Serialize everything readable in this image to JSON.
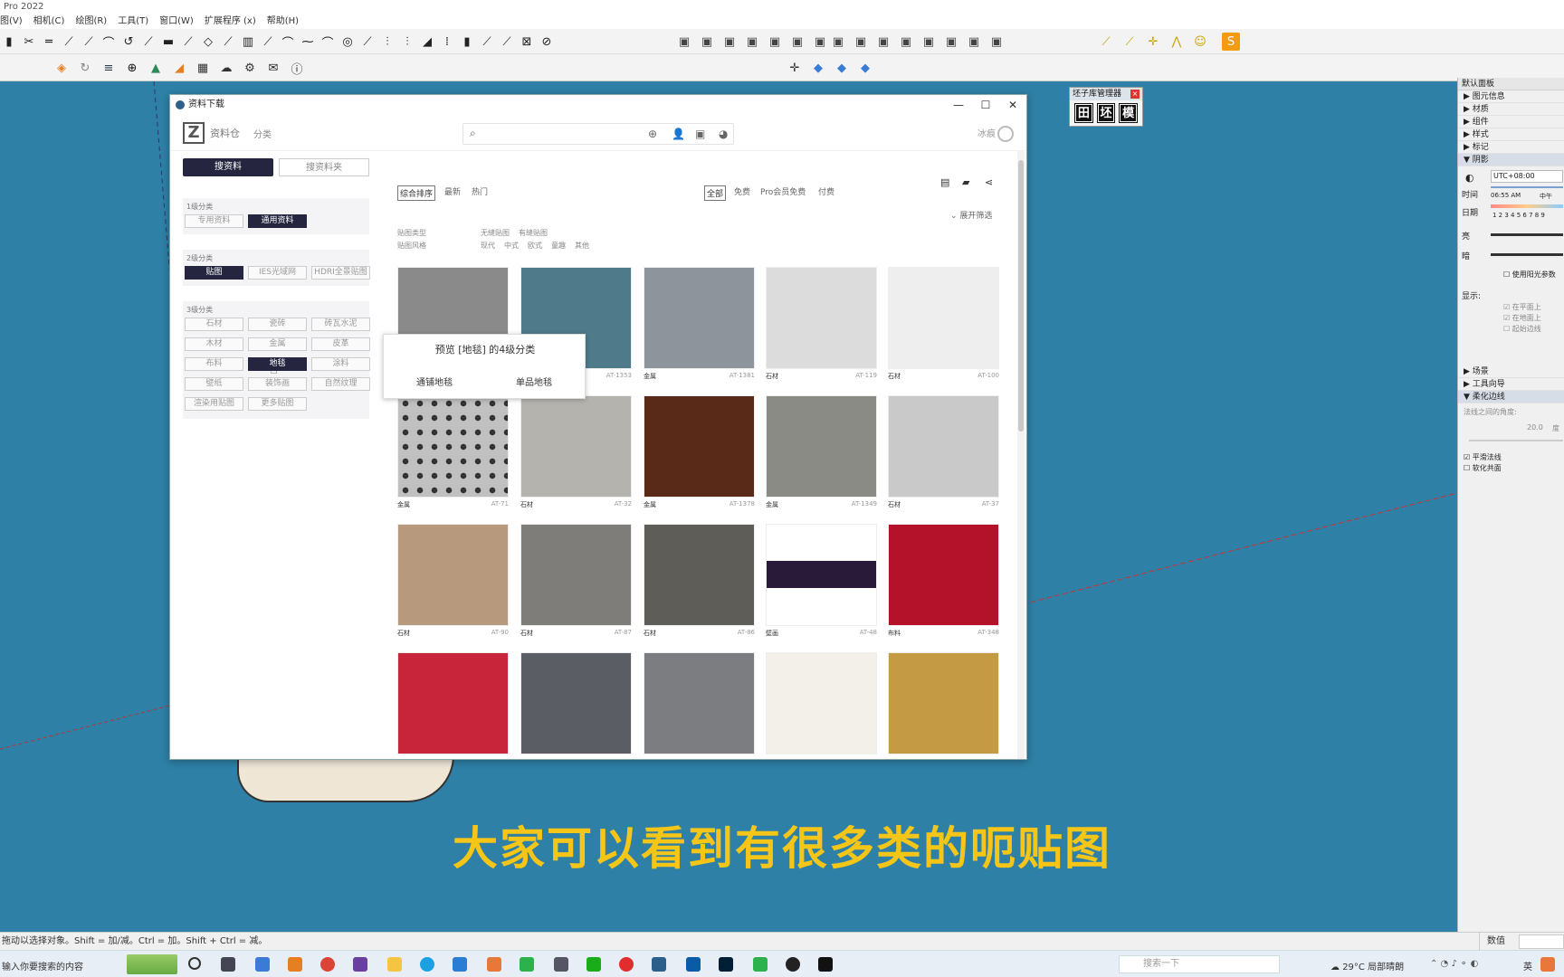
{
  "app": {
    "title": "Pro 2022"
  },
  "menu": [
    "图(V)",
    "相机(C)",
    "绘图(R)",
    "工具(T)",
    "窗口(W)",
    "扩展程序 (x)",
    "帮助(H)"
  ],
  "dialog": {
    "title": "资料下载",
    "brand": "资料仓",
    "brand_sub": "分类",
    "search_placeholder": "",
    "username": "冰痕",
    "tab_search_material": "搜资料",
    "tab_search_set": "搜资料夹",
    "level1": {
      "title": "1级分类",
      "items": [
        "专用资料",
        "通用资料"
      ],
      "active": "通用资料"
    },
    "level2": {
      "title": "2级分类",
      "items": [
        "贴图",
        "IES光域网",
        "HDRI全景贴图"
      ],
      "active": "贴图"
    },
    "level3": {
      "title": "3级分类",
      "items": [
        "石材",
        "瓷砖",
        "砖瓦水泥",
        "木材",
        "金属",
        "皮革",
        "布料",
        "地毯",
        "涂料",
        "壁纸",
        "装饰画",
        "自然纹理",
        "渲染用贴图",
        "更多贴图"
      ],
      "active": "地毯"
    },
    "sort": [
      "综合排序",
      "最新",
      "热门"
    ],
    "price": [
      "全部",
      "免费",
      "Pro会员免费",
      "付费"
    ],
    "expand": "展开筛选",
    "tag_type_label": "贴图类型",
    "tag_type": [
      "无缝贴图",
      "有缝贴图"
    ],
    "tag_style_label": "贴图风格",
    "tag_style": [
      "现代",
      "中式",
      "欧式",
      "童趣",
      "其他"
    ],
    "popup": {
      "title": "预览 [地毯] 的4级分类",
      "items": [
        "通铺地毯",
        "单品地毯"
      ]
    },
    "tiles": [
      {
        "label": "金属",
        "code": "AT-292",
        "color": "#8a8a8a"
      },
      {
        "label": "金属",
        "code": "AT-1353",
        "color": "#4f7a8a"
      },
      {
        "label": "金属",
        "code": "AT-1381",
        "color": "#8e949c"
      },
      {
        "label": "石材",
        "code": "AT-119",
        "color": "#dcdcdc"
      },
      {
        "label": "石材",
        "code": "AT-100",
        "color": "#eeeeee"
      },
      {
        "label": "金属",
        "code": "AT-71",
        "color": "#c0c0c0"
      },
      {
        "label": "石材",
        "code": "AT-32",
        "color": "#b5b3ae"
      },
      {
        "label": "金属",
        "code": "AT-1378",
        "color": "#5a2a18"
      },
      {
        "label": "金属",
        "code": "AT-1349",
        "color": "#8b8b86"
      },
      {
        "label": "石材",
        "code": "AT-37",
        "color": "#c9c9c9"
      },
      {
        "label": "石材",
        "code": "AT-90",
        "color": "#b79a7e"
      },
      {
        "label": "石材",
        "code": "AT-87",
        "color": "#7e7d7a"
      },
      {
        "label": "石材",
        "code": "AT-86",
        "color": "#5f5d58"
      },
      {
        "label": "壁画",
        "code": "AT-48",
        "color": "#ffffff"
      },
      {
        "label": "布料",
        "code": "AT-348",
        "color": "#b3122a"
      },
      {
        "label": "",
        "code": "",
        "color": "#c8253a"
      },
      {
        "label": "",
        "code": "",
        "color": "#5a5d63"
      },
      {
        "label": "",
        "code": "",
        "color": "#7b7d80"
      },
      {
        "label": "",
        "code": "",
        "color": "#f3f0ea"
      },
      {
        "label": "",
        "code": "",
        "color": "#c49a45"
      }
    ]
  },
  "component_manager": {
    "title": "坯子库管理器",
    "buttons": [
      "田",
      "坯",
      "模"
    ]
  },
  "right_panel": {
    "header": "默认面板",
    "sections": [
      "图元信息",
      "材质",
      "组件",
      "样式",
      "标记",
      "阴影"
    ],
    "tz": "UTC+08:00",
    "time_label": "时间",
    "time_val": "06:55 AM",
    "time_mid": "中午",
    "date_label": "日期",
    "date_ticks": "1 2 3 4 5 6 7 8 9",
    "light": "亮",
    "dark": "暗",
    "use_sun": "使用阳光参数",
    "display": "显示:",
    "on_face": "在平面上",
    "on_ground": "在地面上",
    "from_edges": "起始边线",
    "more_sections": [
      "场景",
      "工具向导",
      "柔化边线"
    ],
    "angle_label": "法线之间的角度:",
    "angle_val": "20.0",
    "angle_unit": "度",
    "smooth": "平滑法线",
    "soften": "软化共面"
  },
  "subtitle": "大家可以看到有很多类的呃贴图",
  "status": {
    "hint": "拖动以选择对象。Shift = 加/减。Ctrl = 加。Shift + Ctrl = 减。",
    "value_label": "数值"
  },
  "taskbar": {
    "search": "输入你要搜索的内容",
    "search2": "搜索一下",
    "weather": "29°C 局部晴朗",
    "lang": "英"
  }
}
